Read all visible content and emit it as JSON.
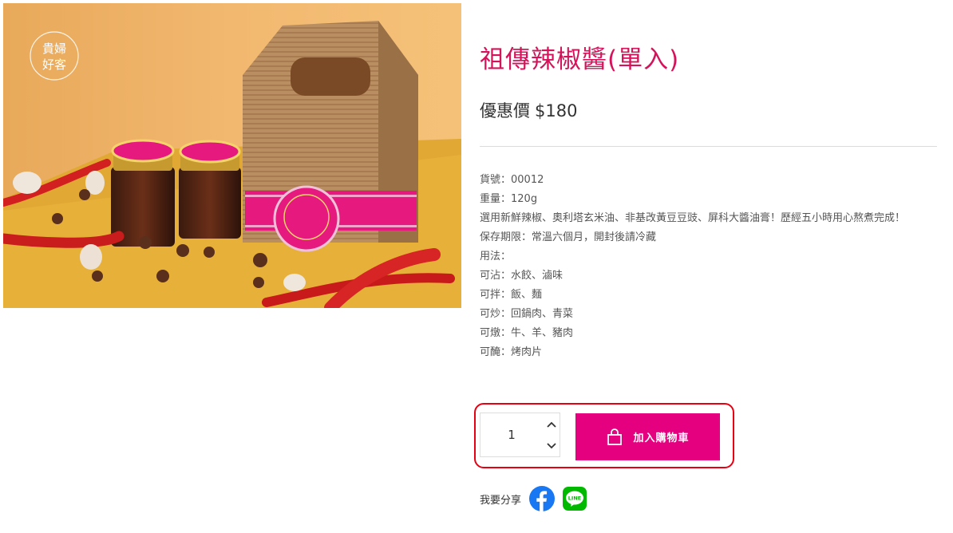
{
  "product": {
    "image_alt": "祖傳辣椒醬產品照",
    "logo_text": "貴婦好客",
    "title": "祖傳辣椒醬(單入)",
    "price_label": "優惠價",
    "price_value": "$180",
    "details": [
      "貨號：00012",
      "重量：120g",
      "選用新鮮辣椒、奧利塔玄米油、非基改黃豆豆豉、屏科大醬油膏！歷經五小時用心熬煮完成！",
      "保存期限：常溫六個月，開封後請冷藏",
      "用法：",
      "可沾：水餃、滷味",
      "可拌：飯、麵",
      "可炒：回鍋肉、青菜",
      "可燉：牛、羊、豬肉",
      "可醃：烤肉片"
    ]
  },
  "purchase": {
    "quantity": "1",
    "add_to_cart_label": "加入購物車"
  },
  "share": {
    "label": "我要分享",
    "facebook_icon": "facebook-icon",
    "line_icon": "line-icon",
    "line_text": "LINE"
  },
  "colors": {
    "title": "#d4145a",
    "button": "#e4007f",
    "highlight": "#e60012",
    "facebook": "#1877f2",
    "line": "#00b900"
  }
}
